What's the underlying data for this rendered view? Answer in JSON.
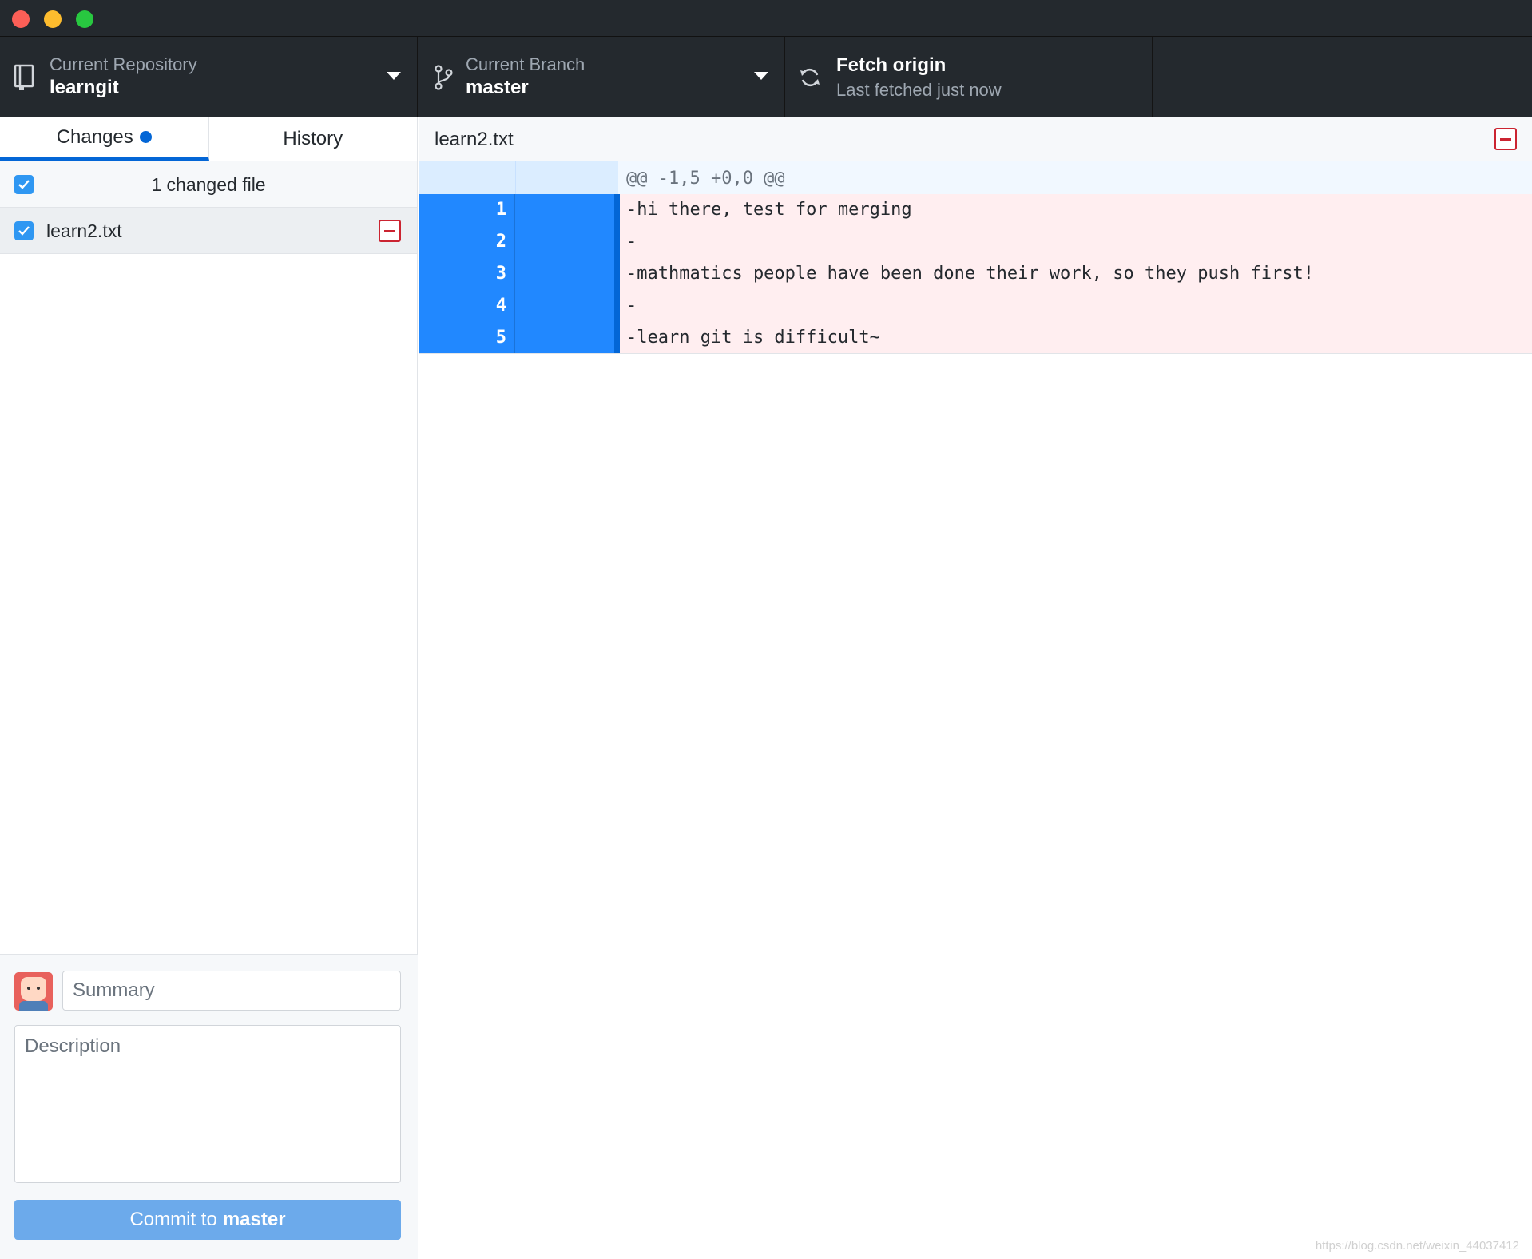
{
  "toolbar": {
    "repository": {
      "label": "Current Repository",
      "value": "learngit",
      "icon": "repo-icon"
    },
    "branch": {
      "label": "Current Branch",
      "value": "master",
      "icon": "git-branch-icon"
    },
    "fetch": {
      "title": "Fetch origin",
      "subtitle": "Last fetched just now",
      "icon": "sync-icon"
    }
  },
  "sidebar": {
    "tabs": [
      {
        "label": "Changes",
        "active": true,
        "has_indicator": true
      },
      {
        "label": "History",
        "active": false
      }
    ],
    "changed_files_count": "1 changed file",
    "files": [
      {
        "name": "learn2.txt",
        "checked": true,
        "status": "removed"
      }
    ],
    "commit": {
      "summary_placeholder": "Summary",
      "description_placeholder": "Description",
      "button_prefix": "Commit to",
      "button_branch": "master"
    }
  },
  "diff": {
    "filename": "learn2.txt",
    "hunk_header": "@@ -1,5 +0,0 @@",
    "lines": [
      {
        "old": "1",
        "text": "-hi there, test for merging"
      },
      {
        "old": "2",
        "text": "-"
      },
      {
        "old": "3",
        "text": "-mathmatics people have been done their work, so they push first!"
      },
      {
        "old": "4",
        "text": "-"
      },
      {
        "old": "5",
        "text": "-learn git is difficult~"
      }
    ]
  },
  "watermark": "https://blog.csdn.net/weixin_44037412",
  "colors": {
    "accent": "#0366d6",
    "selected_line": "#2188ff",
    "deleted_bg": "#ffeef0",
    "removed_icon": "#cb2431",
    "commit_button": "#6caaeb"
  }
}
